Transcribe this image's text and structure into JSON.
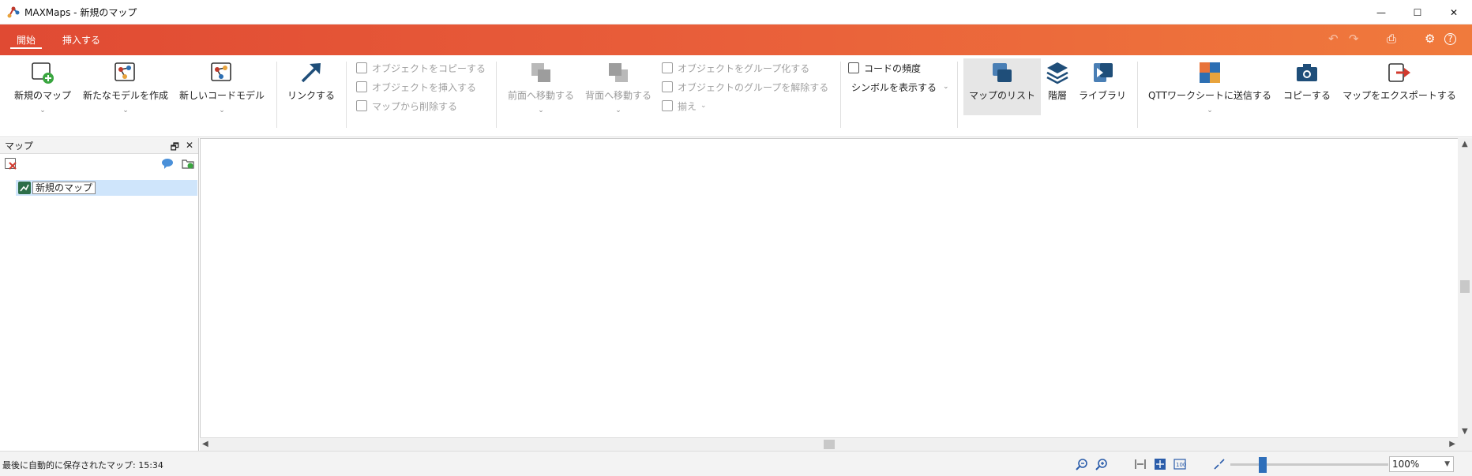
{
  "window": {
    "title": "MAXMaps - 新規のマップ",
    "minimize": "—",
    "maximize": "☐",
    "close": "✕"
  },
  "tabs": [
    {
      "label": "開始",
      "active": true
    },
    {
      "label": "挿入する",
      "active": false
    }
  ],
  "quick_access": {
    "undo": "↶",
    "redo": "↷",
    "print": "⎙",
    "settings": "⚙",
    "help": "?"
  },
  "ribbon": {
    "new_map": "新規のマップ",
    "new_model": "新たなモデルを作成",
    "new_code_model": "新しいコードモデル",
    "link": "リンクする",
    "copy_object": "オブジェクトをコピーする",
    "insert_object": "オブジェクトを挿入する",
    "delete_from_map": "マップから削除する",
    "bring_forward": "前面へ移動する",
    "send_backward": "背面へ移動する",
    "group_objects": "オブジェクトをグループ化する",
    "ungroup_objects": "オブジェクトのグループを解除する",
    "align": "揃え",
    "code_frequency": "コードの頻度",
    "show_symbols": "シンボルを表示する",
    "map_list": "マップのリスト",
    "layers": "階層",
    "library": "ライブラリ",
    "send_qtt": "QTTワークシートに送信する",
    "copy": "コピーする",
    "export_map": "マップをエクスポートする",
    "caret": "⌄"
  },
  "panel": {
    "title": "マップ",
    "float": "🗗",
    "close": "✕",
    "items": [
      {
        "label": "新規のマップ"
      }
    ]
  },
  "statusbar": {
    "autosave": "最後に自動的に保存されたマップ: 15:34",
    "zoom": "100%"
  },
  "colors": {
    "accent_start": "#e04a33",
    "accent_end": "#f07a3c",
    "selection": "#cfe5fb",
    "icon_blue": "#1f4e79"
  }
}
